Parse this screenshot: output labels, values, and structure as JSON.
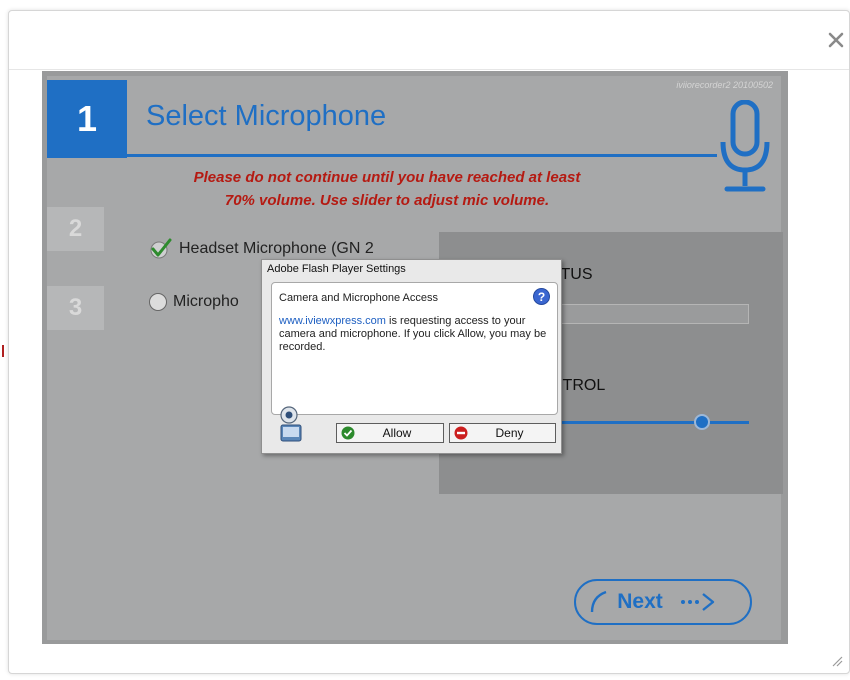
{
  "dialog": {
    "close_icon": "close-icon",
    "resize_icon": "resize-grip-icon"
  },
  "app": {
    "version": "iviiorecorder2 20100502",
    "steps": [
      "1",
      "2",
      "3"
    ],
    "title": "Select Microphone",
    "warning_line1": "Please do not continue until you have reached at least",
    "warning_line2": "70% volume. Use slider to adjust mic volume.",
    "options": [
      {
        "label": "Headset Microphone (GN 2",
        "selected": true
      },
      {
        "label": "Micropho",
        "selected": false
      }
    ],
    "status_label": "ATUS",
    "control_label": "NTROL",
    "volume_level": 0.75,
    "next_label": "Next",
    "accent_color": "#1f6fc4",
    "warning_color": "#b51a12"
  },
  "flash": {
    "title": "Adobe Flash Player Settings",
    "heading": "Camera and Microphone Access",
    "help_label": "?",
    "link": "www.iviewxpress.com",
    "message_rest": " is requesting access to your camera and microphone. If you click Allow, you may be recorded.",
    "allow_label": "Allow",
    "deny_label": "Deny"
  }
}
